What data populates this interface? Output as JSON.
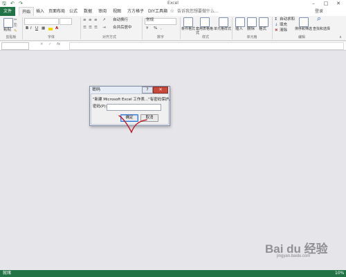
{
  "window": {
    "title": "Excel",
    "minimize_icon": "minimize-icon",
    "restore_icon": "restore-icon",
    "close_icon": "close-icon"
  },
  "quick_access": [
    "save-icon",
    "undo-icon",
    "redo-icon"
  ],
  "ribbon": {
    "file_tab": "文件",
    "tabs": [
      "开始",
      "插入",
      "页面布局",
      "公式",
      "数据",
      "审阅",
      "视图",
      "方方格子",
      "DIY工具箱"
    ],
    "active_tab": "开始",
    "tell_me": "告诉我您想要做什么...",
    "login": "登录",
    "groups": {
      "clipboard": {
        "label": "剪贴板",
        "paste": "粘贴"
      },
      "font": {
        "label": "字体",
        "bold": "B",
        "italic": "I",
        "underline": "U"
      },
      "alignment": {
        "label": "对齐方式",
        "wrap": "自动换行",
        "merge": "合并后居中"
      },
      "number": {
        "label": "数字",
        "format": "常规",
        "percent": "%"
      },
      "styles": {
        "label": "样式",
        "conditional": "条件格式",
        "table": "套用表格格式",
        "cell_styles": "单元格样式"
      },
      "cells": {
        "label": "单元格",
        "insert": "插入",
        "delete": "删除",
        "format": "格式"
      },
      "editing": {
        "label": "编辑",
        "autosum": "自动求和",
        "fill": "填充",
        "clear": "清除",
        "sort": "排序和筛选",
        "find": "查找和选择"
      }
    }
  },
  "formula_bar": {
    "namebox": "",
    "fx": "fx",
    "content": ""
  },
  "dialog": {
    "title": "密码",
    "help": "?",
    "close": "✕",
    "message": "\"新建 Microsoft Excel 工作表...\"有密码保护。",
    "password_label": "密码(P):",
    "password_value": "",
    "ok": "确定",
    "cancel": "取消"
  },
  "status": {
    "text": "就绪",
    "zoom": "10%"
  },
  "watermark": {
    "brand": "Bai du 经验",
    "sub": "jingyan.baidu.com"
  },
  "colors": {
    "excel_green": "#217346",
    "annotation_red": "#c0192a"
  }
}
